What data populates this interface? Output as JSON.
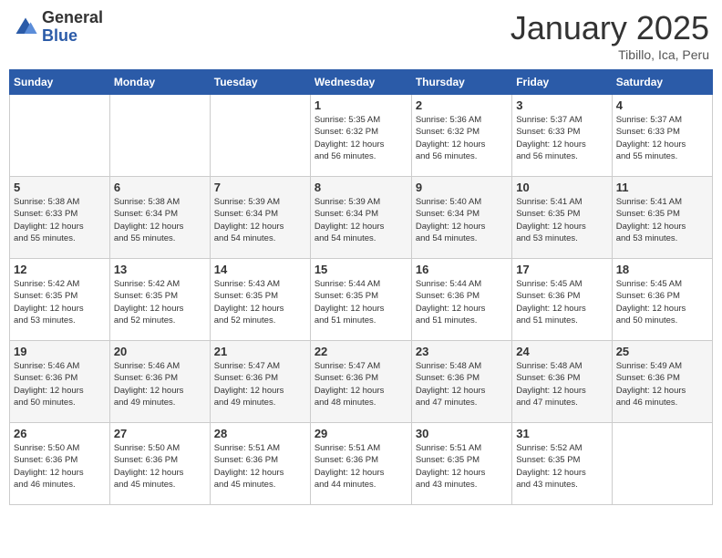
{
  "header": {
    "logo_general": "General",
    "logo_blue": "Blue",
    "title": "January 2025",
    "subtitle": "Tibillo, Ica, Peru"
  },
  "days_of_week": [
    "Sunday",
    "Monday",
    "Tuesday",
    "Wednesday",
    "Thursday",
    "Friday",
    "Saturday"
  ],
  "weeks": [
    [
      {
        "day": "",
        "info": ""
      },
      {
        "day": "",
        "info": ""
      },
      {
        "day": "",
        "info": ""
      },
      {
        "day": "1",
        "info": "Sunrise: 5:35 AM\nSunset: 6:32 PM\nDaylight: 12 hours\nand 56 minutes."
      },
      {
        "day": "2",
        "info": "Sunrise: 5:36 AM\nSunset: 6:32 PM\nDaylight: 12 hours\nand 56 minutes."
      },
      {
        "day": "3",
        "info": "Sunrise: 5:37 AM\nSunset: 6:33 PM\nDaylight: 12 hours\nand 56 minutes."
      },
      {
        "day": "4",
        "info": "Sunrise: 5:37 AM\nSunset: 6:33 PM\nDaylight: 12 hours\nand 55 minutes."
      }
    ],
    [
      {
        "day": "5",
        "info": "Sunrise: 5:38 AM\nSunset: 6:33 PM\nDaylight: 12 hours\nand 55 minutes."
      },
      {
        "day": "6",
        "info": "Sunrise: 5:38 AM\nSunset: 6:34 PM\nDaylight: 12 hours\nand 55 minutes."
      },
      {
        "day": "7",
        "info": "Sunrise: 5:39 AM\nSunset: 6:34 PM\nDaylight: 12 hours\nand 54 minutes."
      },
      {
        "day": "8",
        "info": "Sunrise: 5:39 AM\nSunset: 6:34 PM\nDaylight: 12 hours\nand 54 minutes."
      },
      {
        "day": "9",
        "info": "Sunrise: 5:40 AM\nSunset: 6:34 PM\nDaylight: 12 hours\nand 54 minutes."
      },
      {
        "day": "10",
        "info": "Sunrise: 5:41 AM\nSunset: 6:35 PM\nDaylight: 12 hours\nand 53 minutes."
      },
      {
        "day": "11",
        "info": "Sunrise: 5:41 AM\nSunset: 6:35 PM\nDaylight: 12 hours\nand 53 minutes."
      }
    ],
    [
      {
        "day": "12",
        "info": "Sunrise: 5:42 AM\nSunset: 6:35 PM\nDaylight: 12 hours\nand 53 minutes."
      },
      {
        "day": "13",
        "info": "Sunrise: 5:42 AM\nSunset: 6:35 PM\nDaylight: 12 hours\nand 52 minutes."
      },
      {
        "day": "14",
        "info": "Sunrise: 5:43 AM\nSunset: 6:35 PM\nDaylight: 12 hours\nand 52 minutes."
      },
      {
        "day": "15",
        "info": "Sunrise: 5:44 AM\nSunset: 6:35 PM\nDaylight: 12 hours\nand 51 minutes."
      },
      {
        "day": "16",
        "info": "Sunrise: 5:44 AM\nSunset: 6:36 PM\nDaylight: 12 hours\nand 51 minutes."
      },
      {
        "day": "17",
        "info": "Sunrise: 5:45 AM\nSunset: 6:36 PM\nDaylight: 12 hours\nand 51 minutes."
      },
      {
        "day": "18",
        "info": "Sunrise: 5:45 AM\nSunset: 6:36 PM\nDaylight: 12 hours\nand 50 minutes."
      }
    ],
    [
      {
        "day": "19",
        "info": "Sunrise: 5:46 AM\nSunset: 6:36 PM\nDaylight: 12 hours\nand 50 minutes."
      },
      {
        "day": "20",
        "info": "Sunrise: 5:46 AM\nSunset: 6:36 PM\nDaylight: 12 hours\nand 49 minutes."
      },
      {
        "day": "21",
        "info": "Sunrise: 5:47 AM\nSunset: 6:36 PM\nDaylight: 12 hours\nand 49 minutes."
      },
      {
        "day": "22",
        "info": "Sunrise: 5:47 AM\nSunset: 6:36 PM\nDaylight: 12 hours\nand 48 minutes."
      },
      {
        "day": "23",
        "info": "Sunrise: 5:48 AM\nSunset: 6:36 PM\nDaylight: 12 hours\nand 47 minutes."
      },
      {
        "day": "24",
        "info": "Sunrise: 5:48 AM\nSunset: 6:36 PM\nDaylight: 12 hours\nand 47 minutes."
      },
      {
        "day": "25",
        "info": "Sunrise: 5:49 AM\nSunset: 6:36 PM\nDaylight: 12 hours\nand 46 minutes."
      }
    ],
    [
      {
        "day": "26",
        "info": "Sunrise: 5:50 AM\nSunset: 6:36 PM\nDaylight: 12 hours\nand 46 minutes."
      },
      {
        "day": "27",
        "info": "Sunrise: 5:50 AM\nSunset: 6:36 PM\nDaylight: 12 hours\nand 45 minutes."
      },
      {
        "day": "28",
        "info": "Sunrise: 5:51 AM\nSunset: 6:36 PM\nDaylight: 12 hours\nand 45 minutes."
      },
      {
        "day": "29",
        "info": "Sunrise: 5:51 AM\nSunset: 6:36 PM\nDaylight: 12 hours\nand 44 minutes."
      },
      {
        "day": "30",
        "info": "Sunrise: 5:51 AM\nSunset: 6:35 PM\nDaylight: 12 hours\nand 43 minutes."
      },
      {
        "day": "31",
        "info": "Sunrise: 5:52 AM\nSunset: 6:35 PM\nDaylight: 12 hours\nand 43 minutes."
      },
      {
        "day": "",
        "info": ""
      }
    ]
  ]
}
